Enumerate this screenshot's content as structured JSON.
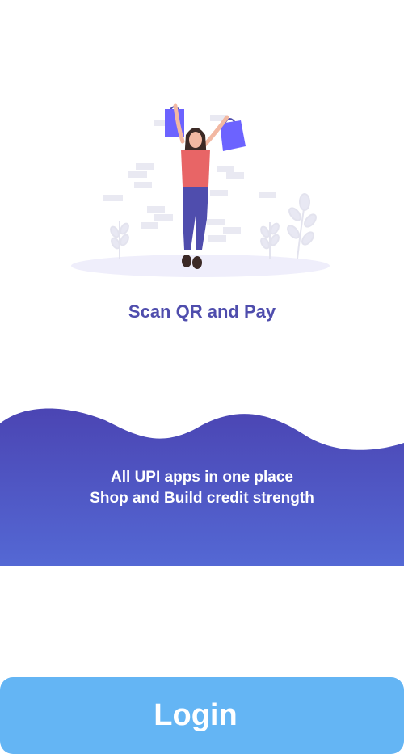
{
  "illustration": {
    "icon": "shopping-woman-illustration"
  },
  "headline": "Scan QR and Pay",
  "banner": {
    "line1": "All UPI apps in one place",
    "line2": "Shop and Build credit strength",
    "gradient_top": "#4b45b3",
    "gradient_bottom": "#5468d4"
  },
  "login_button": {
    "label": "Login",
    "color": "#64b5f4"
  },
  "colors": {
    "accent": "#4f4dad",
    "bag": "#6c63ff",
    "shirt": "#e86566"
  }
}
